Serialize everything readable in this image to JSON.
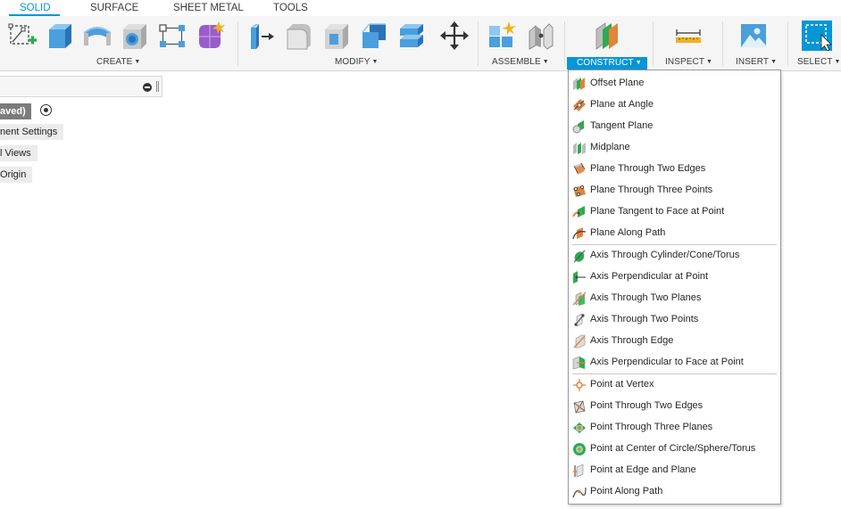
{
  "tabs": [
    {
      "label": "SOLID",
      "active": true
    },
    {
      "label": "SURFACE",
      "active": false
    },
    {
      "label": "SHEET METAL",
      "active": false
    },
    {
      "label": "TOOLS",
      "active": false
    }
  ],
  "groups": {
    "create": "CREATE",
    "modify": "MODIFY",
    "assemble": "ASSEMBLE",
    "construct": "CONSTRUCT",
    "inspect": "INSPECT",
    "insert": "INSERT",
    "select": "SELECT"
  },
  "caret": "▼",
  "tools": {
    "create": [
      "create-sketch-icon",
      "extrude-icon",
      "revolve-icon",
      "hole-icon",
      "pattern-icon",
      "create-form-icon"
    ],
    "modify": [
      "press-pull-icon",
      "fillet-icon",
      "shell-icon",
      "combine-icon",
      "split-face-icon",
      "move-icon"
    ],
    "assemble": [
      "new-component-icon",
      "joint-icon"
    ],
    "construct": [
      "offset-plane-icon"
    ],
    "inspect": [
      "measure-icon"
    ],
    "insert": [
      "insert-image-icon"
    ],
    "select": [
      "select-window-icon"
    ]
  },
  "browser": {
    "document_label": "aved)",
    "nodes": [
      "nent Settings",
      "l Views",
      "Origin"
    ]
  },
  "menu": {
    "planes": [
      {
        "label": "Offset Plane",
        "icon": "offset-plane-icon"
      },
      {
        "label": "Plane at Angle",
        "icon": "plane-at-angle-icon"
      },
      {
        "label": "Tangent Plane",
        "icon": "tangent-plane-icon"
      },
      {
        "label": "Midplane",
        "icon": "midplane-icon"
      },
      {
        "label": "Plane Through Two Edges",
        "icon": "plane-two-edges-icon"
      },
      {
        "label": "Plane Through Three Points",
        "icon": "plane-three-points-icon"
      },
      {
        "label": "Plane Tangent to Face at Point",
        "icon": "plane-tangent-face-icon"
      },
      {
        "label": "Plane Along Path",
        "icon": "plane-along-path-icon"
      }
    ],
    "axes": [
      {
        "label": "Axis Through Cylinder/Cone/Torus",
        "icon": "axis-cylinder-icon"
      },
      {
        "label": "Axis Perpendicular at Point",
        "icon": "axis-perpendicular-point-icon"
      },
      {
        "label": "Axis Through Two Planes",
        "icon": "axis-two-planes-icon"
      },
      {
        "label": "Axis Through Two Points",
        "icon": "axis-two-points-icon"
      },
      {
        "label": "Axis Through Edge",
        "icon": "axis-edge-icon"
      },
      {
        "label": "Axis Perpendicular to Face at Point",
        "icon": "axis-perpendicular-face-icon"
      }
    ],
    "points": [
      {
        "label": "Point at Vertex",
        "icon": "point-vertex-icon"
      },
      {
        "label": "Point Through Two Edges",
        "icon": "point-two-edges-icon"
      },
      {
        "label": "Point Through Three Planes",
        "icon": "point-three-planes-icon"
      },
      {
        "label": "Point at Center of Circle/Sphere/Torus",
        "icon": "point-center-icon"
      },
      {
        "label": "Point at Edge and Plane",
        "icon": "point-edge-plane-icon"
      },
      {
        "label": "Point Along Path",
        "icon": "point-along-path-icon"
      }
    ]
  },
  "colors": {
    "accent": "#0696d7",
    "toolbar_bg": "#f5f5f5",
    "icon_blue": "#4a9fdc",
    "icon_green": "#2eaa4f",
    "icon_orange": "#e0853a",
    "icon_purple": "#9a5cc9"
  }
}
